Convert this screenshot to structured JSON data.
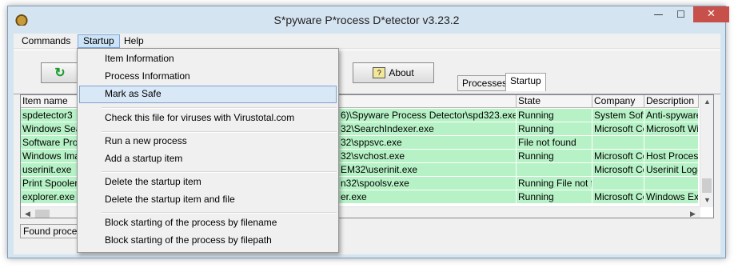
{
  "window": {
    "title": "S*pyware P*rocess D*etector v3.23.2",
    "controls": {
      "minimize": "—",
      "maximize": "☐",
      "close": "✕"
    }
  },
  "menubar": {
    "items": [
      "Commands",
      "Startup",
      "Help"
    ],
    "active": "Startup"
  },
  "toolbar": {
    "about_label": "About",
    "about_icon": "about-book-icon",
    "refresh_icon": "refresh-icon"
  },
  "tabs": {
    "items": [
      "Processes",
      "Startup"
    ],
    "selected": "Startup"
  },
  "table": {
    "columns": [
      "Item name",
      "",
      "State",
      "Company",
      "Description"
    ],
    "rows": [
      [
        "spdetector3",
        "6)\\Spyware Process Detector\\spd323.exe",
        "Running",
        "System  SoftLAB",
        "Anti-spyware"
      ],
      [
        "Windows Sear",
        "32\\SearchIndexer.exe",
        "Running",
        "Microsoft Corp",
        "Microsoft Windows"
      ],
      [
        "Software Prot",
        "32\\sppsvc.exe",
        "File not found",
        "",
        ""
      ],
      [
        "Windows Ima",
        "32\\svchost.exe",
        "Running",
        "Microsoft Corp",
        "Host Process"
      ],
      [
        "userinit.exe",
        "EM32\\userinit.exe",
        "",
        "Microsoft Corp",
        "Userinit Log-on"
      ],
      [
        "Print Spooler",
        "n32\\spoolsv.exe",
        "Running File not found",
        "",
        ""
      ],
      [
        "explorer.exe",
        "er.exe",
        "Running",
        "Microsoft Corp",
        "Windows Explorer"
      ]
    ],
    "row_color": "#b6f2c6"
  },
  "status": {
    "text": "Found processes"
  },
  "dropdown": {
    "groups": [
      [
        "Item Information",
        "Process Information",
        "Mark as Safe"
      ],
      [
        "Check this file for viruses with Virustotal.com"
      ],
      [
        "Run a new process",
        "Add a startup item"
      ],
      [
        "Delete the startup item",
        "Delete the startup item and file"
      ],
      [
        "Block starting of the process by filename",
        "Block starting of the process by filepath"
      ]
    ],
    "highlighted": "Mark as Safe"
  }
}
